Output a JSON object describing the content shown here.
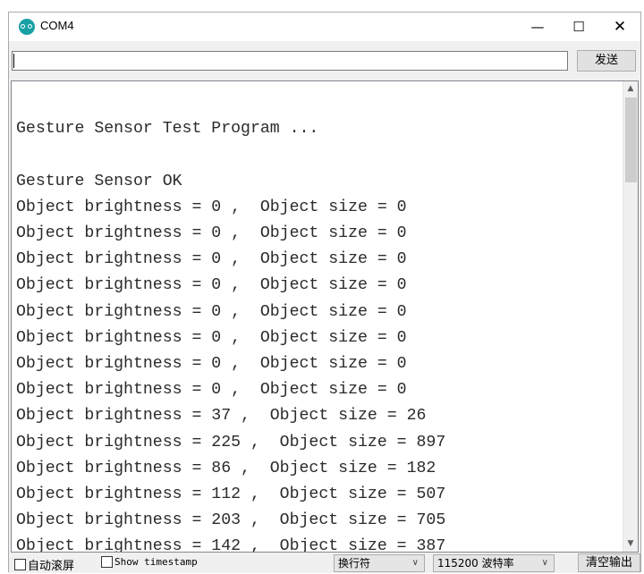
{
  "window": {
    "title": "COM4"
  },
  "controls": {
    "minimize": "—",
    "maximize": "☐",
    "close": "✕"
  },
  "input": {
    "value": "",
    "send_label": "发送"
  },
  "output": {
    "lines": [
      "",
      "Gesture Sensor Test Program ...",
      "",
      "Gesture Sensor OK",
      "Object brightness = 0 ,  Object size = 0",
      "Object brightness = 0 ,  Object size = 0",
      "Object brightness = 0 ,  Object size = 0",
      "Object brightness = 0 ,  Object size = 0",
      "Object brightness = 0 ,  Object size = 0",
      "Object brightness = 0 ,  Object size = 0",
      "Object brightness = 0 ,  Object size = 0",
      "Object brightness = 0 ,  Object size = 0",
      "Object brightness = 37 ,  Object size = 26",
      "Object brightness = 225 ,  Object size = 897",
      "Object brightness = 86 ,  Object size = 182",
      "Object brightness = 112 ,  Object size = 507",
      "Object brightness = 203 ,  Object size = 705",
      "Object brightness = 142 ,  Object size = 387"
    ]
  },
  "status": {
    "autoscroll_label": "自动滚屏",
    "timestamp_label": "Show timestamp",
    "line_ending": "换行符",
    "baud_rate": "115200 波特率",
    "clear_label": "清空输出"
  },
  "colors": {
    "icon_teal": "#17a1a5",
    "text": "#2b2b2b"
  }
}
